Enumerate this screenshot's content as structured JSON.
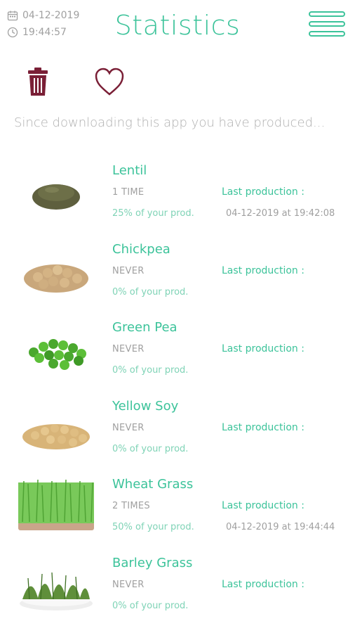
{
  "status": {
    "date": "04-12-2019",
    "time": "19:44:57"
  },
  "header": {
    "title": "Statistics",
    "menu_icon": "hamburger-menu-icon"
  },
  "actions": {
    "delete_icon": "trash-icon",
    "favorite_icon": "heart-icon"
  },
  "intro_text": "Since downloading this app you have produced...",
  "colors": {
    "accent": "#3cc39a",
    "accent_light": "#7fd3b6",
    "muted": "#a0a0a0",
    "icon_dark": "#7a1f36"
  },
  "items": [
    {
      "name": "Lentil",
      "times": "1 TIME",
      "percent": "25% of your prod.",
      "last_label": "Last production :",
      "last_date": "04-12-2019 at 19:42:08",
      "image": "lentil"
    },
    {
      "name": "Chickpea",
      "times": "NEVER",
      "percent": "0% of your prod.",
      "last_label": "Last production :",
      "last_date": "",
      "image": "chickpea"
    },
    {
      "name": "Green Pea",
      "times": "NEVER",
      "percent": "0% of your prod.",
      "last_label": "Last production :",
      "last_date": "",
      "image": "green-pea"
    },
    {
      "name": "Yellow Soy",
      "times": "NEVER",
      "percent": "0% of your prod.",
      "last_label": "Last production :",
      "last_date": "",
      "image": "yellow-soy"
    },
    {
      "name": "Wheat Grass",
      "times": "2 TIMES",
      "percent": "50% of your prod.",
      "last_label": "Last production :",
      "last_date": "04-12-2019 at 19:44:44",
      "image": "wheat-grass"
    },
    {
      "name": "Barley Grass",
      "times": "NEVER",
      "percent": "0% of your prod.",
      "last_label": "Last production :",
      "last_date": "",
      "image": "barley-grass"
    }
  ]
}
